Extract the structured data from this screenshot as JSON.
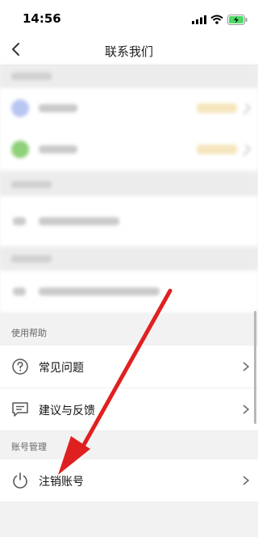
{
  "status": {
    "time": "14:56"
  },
  "nav": {
    "title": "联系我们"
  },
  "help": {
    "section_title": "使用帮助",
    "items": [
      {
        "label": "常见问题"
      },
      {
        "label": "建议与反馈"
      }
    ]
  },
  "account": {
    "section_title": "账号管理",
    "items": [
      {
        "label": "注销账号"
      }
    ]
  },
  "colors": {
    "annotation_arrow": "#e02020",
    "background": "#f2f2f2",
    "battery": "#4cd964"
  }
}
